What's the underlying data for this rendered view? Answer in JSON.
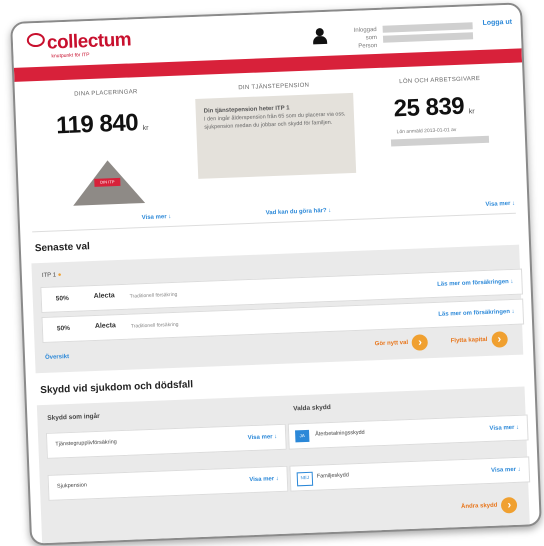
{
  "header": {
    "logo_text": "collectum",
    "logo_sub": "knutpunkt för ITP",
    "logged_in_label": "Inloggad som",
    "person_label": "Person",
    "logout": "Logga ut"
  },
  "placements": {
    "title": "DINA PLACERINGAR",
    "amount": "119 840",
    "unit": "kr",
    "pyramid_label": "DIN ITP",
    "link": "Visa mer"
  },
  "pension": {
    "title": "DIN TJÄNSTEPENSION",
    "box_title": "Din tjänstepension heter ITP 1",
    "box_text": "I den ingår ålderspension från 65 som du placerar via oss, sjukpension medan du jobbar och skydd för familjen.",
    "link": "Vad kan du göra här?"
  },
  "salary": {
    "title": "LÖN OCH ARBETSGIVARE",
    "amount": "25 839",
    "unit": "kr",
    "reported": "Lön anmäld 2013-01-01 av",
    "link": "Visa mer"
  },
  "latest": {
    "title": "Senaste val",
    "itp_label": "ITP 1",
    "rows": [
      {
        "pct": "50%",
        "company": "Alecta",
        "insurance": "Traditionell försäkring",
        "more": "Läs mer om försäkringen"
      },
      {
        "pct": "50%",
        "company": "Alecta",
        "insurance": "Traditionell försäkring",
        "more": "Läs mer om försäkringen"
      }
    ],
    "overview": "Översikt",
    "new_choice": "Gör nytt val",
    "move_capital": "Flytta kapital"
  },
  "protection": {
    "title": "Skydd vid sjukdom och dödsfall",
    "included_title": "Skydd som ingår",
    "included": [
      {
        "name": "Tjänstegrupplivförsäkring",
        "more": "Visa mer"
      },
      {
        "name": "Sjukpension",
        "more": "Visa mer"
      }
    ],
    "chosen_title": "Valda skydd",
    "chosen": [
      {
        "badge": "JA",
        "name": "Återbetalningsskydd",
        "more": "Visa mer"
      },
      {
        "badge": "NEJ",
        "name": "Familjeskydd",
        "more": "Visa mer"
      }
    ],
    "change": "Ändra skydd"
  },
  "colors": {
    "brand_red": "#d8213a",
    "link_blue": "#2b88d8",
    "action_orange": "#f0a030"
  }
}
